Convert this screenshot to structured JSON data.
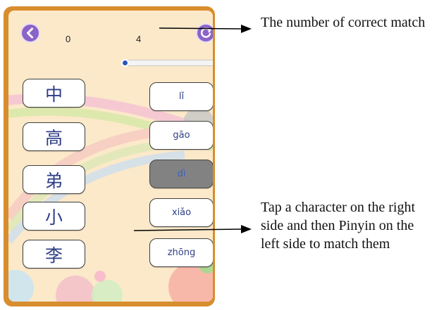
{
  "scores": {
    "correct": "0",
    "total": "4"
  },
  "progress": {
    "fraction": 0.02
  },
  "characters": [
    "中",
    "高",
    "弟",
    "小",
    "李"
  ],
  "pinyin": [
    {
      "text": "lǐ",
      "selected": false
    },
    {
      "text": "gāo",
      "selected": false
    },
    {
      "text": "dì",
      "selected": true
    },
    {
      "text": "xiǎo",
      "selected": false
    },
    {
      "text": "zhōng",
      "selected": false
    }
  ],
  "annotations": {
    "top": "The number of correct match",
    "bottom": "Tap a character on the right side and then Pinyin on the left side to match them"
  },
  "icons": {
    "back": "back-icon",
    "reset": "reset-icon",
    "arrow": "arrow-icon"
  },
  "colors": {
    "frame": "#d88d2e",
    "button": "#8c63c7",
    "selected_card": "#828282",
    "card_text": "#2e3e86"
  }
}
